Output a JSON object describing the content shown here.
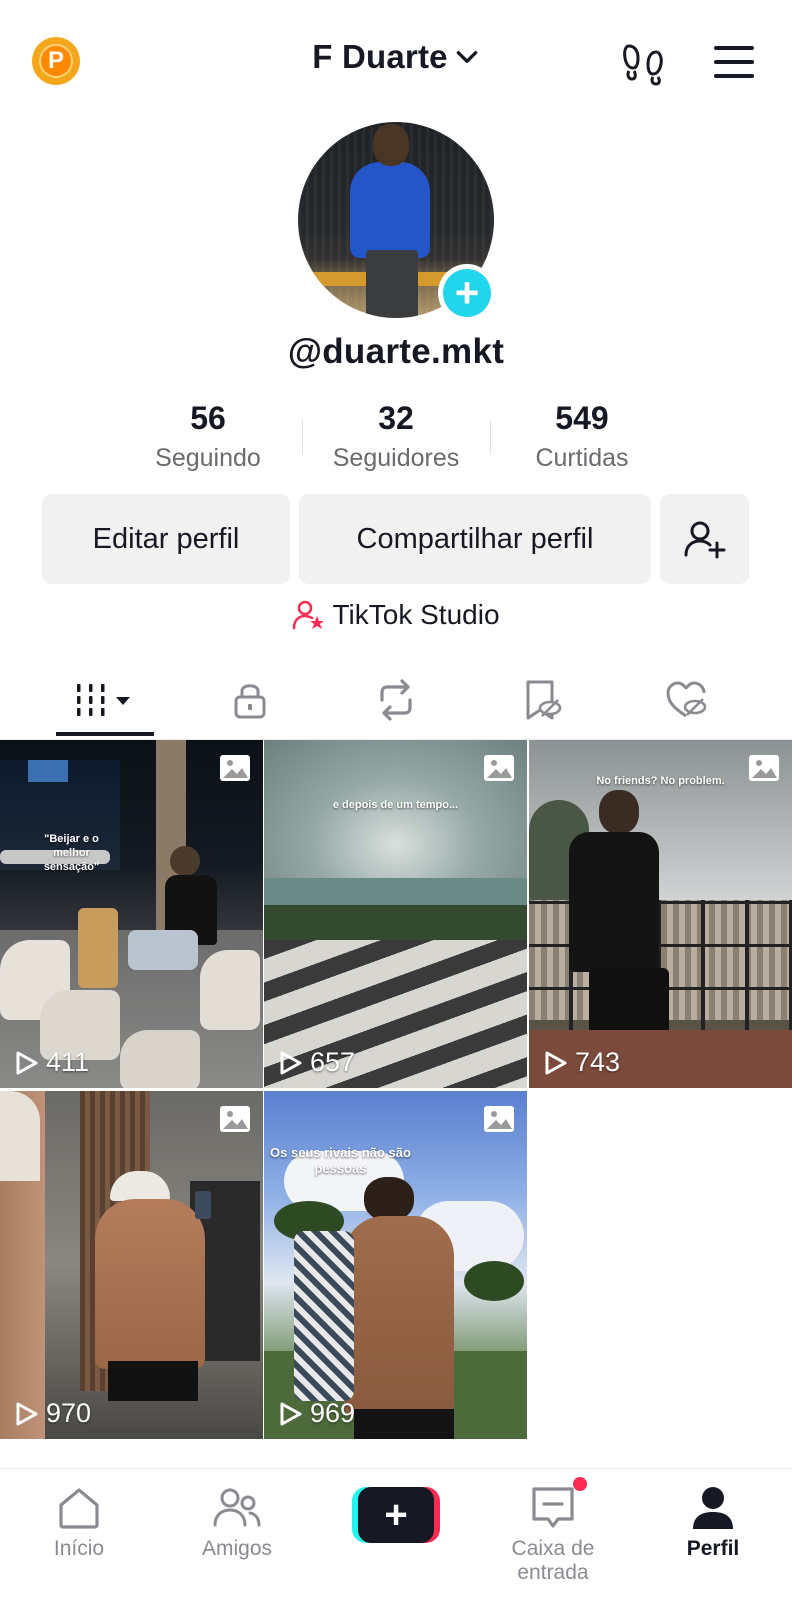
{
  "header": {
    "display_name": "F Duarte",
    "badge_letter": "P"
  },
  "profile": {
    "username": "@duarte.mkt",
    "stats": [
      {
        "value": "56",
        "label": "Seguindo"
      },
      {
        "value": "32",
        "label": "Seguidores"
      },
      {
        "value": "549",
        "label": "Curtidas"
      }
    ],
    "buttons": {
      "edit": "Editar perfil",
      "share": "Compartilhar perfil"
    },
    "studio_label": "TikTok Studio"
  },
  "tabs": [
    {
      "name": "videos",
      "icon": "grid-icon",
      "active": true
    },
    {
      "name": "private",
      "icon": "lock-icon"
    },
    {
      "name": "reposts",
      "icon": "repost-icon"
    },
    {
      "name": "favorites",
      "icon": "bookmark-hidden-icon"
    },
    {
      "name": "liked",
      "icon": "heart-hidden-icon"
    }
  ],
  "posts": [
    {
      "views": "411",
      "caption": "\"Beijar e o melhor sensação\""
    },
    {
      "views": "657",
      "caption": "e depois de um tempo..."
    },
    {
      "views": "743",
      "caption": "No friends? No problem."
    },
    {
      "views": "970",
      "caption": ""
    },
    {
      "views": "969",
      "caption": "Os seus rivais não são pessoas"
    }
  ],
  "bottom_nav": {
    "home": "Início",
    "friends": "Amigos",
    "inbox": "Caixa de entrada",
    "profile": "Perfil"
  },
  "colors": {
    "accent_cyan": "#20d5ec",
    "accent_red": "#fe2c55",
    "text_primary": "#161823"
  }
}
